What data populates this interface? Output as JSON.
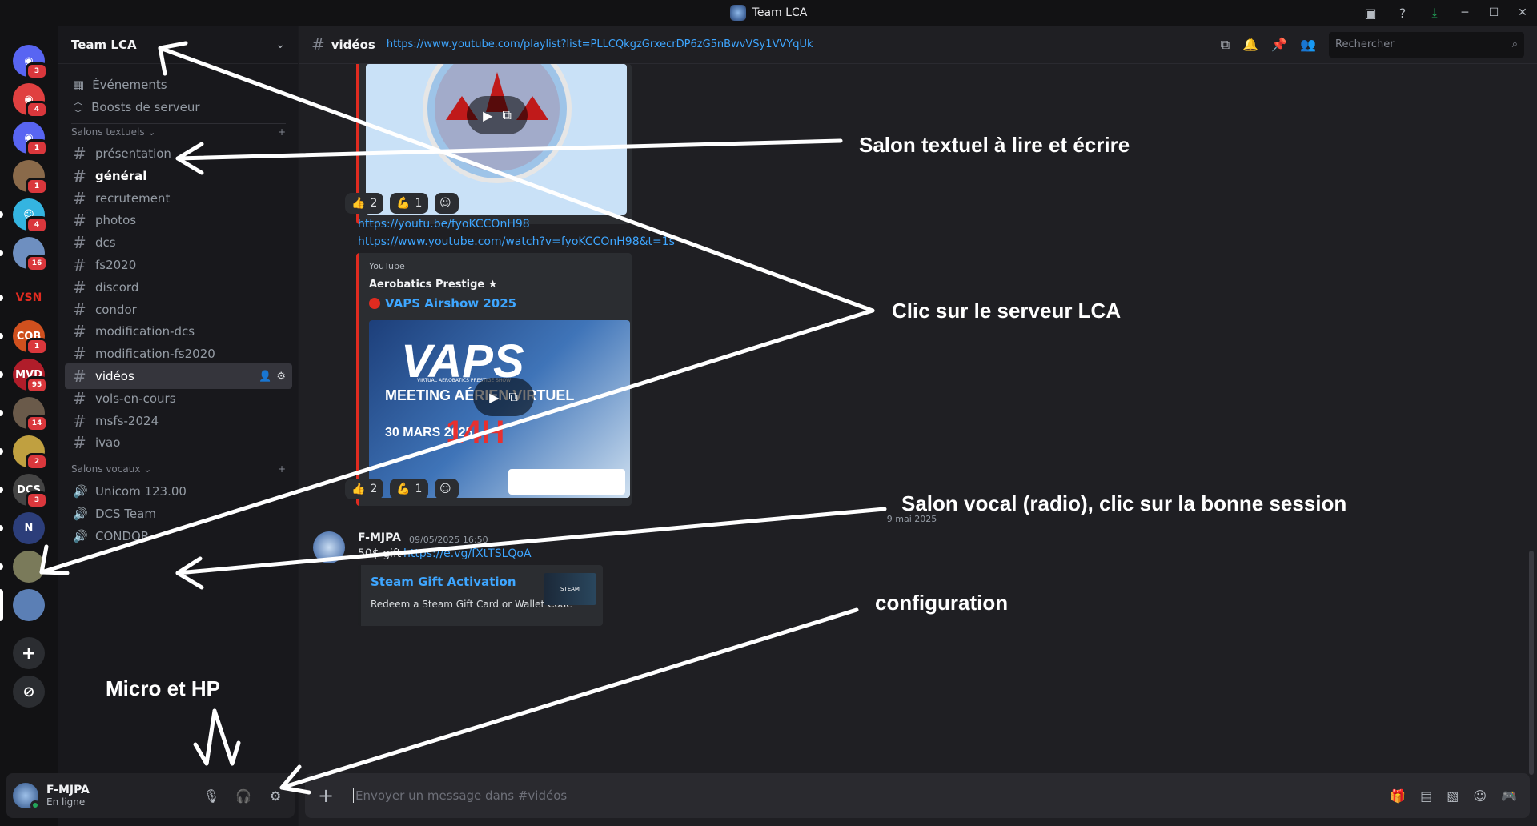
{
  "window": {
    "title": "Team LCA"
  },
  "rail": {
    "servers": [
      {
        "name": "discord-home",
        "badge": "3",
        "color": "#5865f2",
        "glyph": "◉"
      },
      {
        "name": "server-2",
        "badge": "4",
        "color": "#e04040",
        "glyph": "◉"
      },
      {
        "name": "server-3",
        "badge": "1",
        "color": "#5865f2",
        "glyph": "◉"
      },
      {
        "name": "server-4",
        "badge": "1",
        "color": "#8a6a4a",
        "glyph": ""
      },
      {
        "name": "server-5",
        "badge": "4",
        "color": "#34b4e0",
        "glyph": "☺"
      },
      {
        "name": "server-6",
        "badge": "16",
        "color": "#6e8fc0",
        "glyph": ""
      },
      {
        "name": "server-vsn",
        "badge": "",
        "color": "#121214",
        "glyph": "VSN"
      },
      {
        "name": "server-8",
        "badge": "1",
        "color": "#d0501e",
        "glyph": "CQB"
      },
      {
        "name": "server-mvd",
        "badge": "95",
        "color": "#b01d2a",
        "glyph": "MVD"
      },
      {
        "name": "server-10",
        "badge": "14",
        "color": "#6a5a4a",
        "glyph": ""
      },
      {
        "name": "server-11",
        "badge": "2",
        "color": "#c0a040",
        "glyph": ""
      },
      {
        "name": "server-dcs",
        "badge": "3",
        "color": "#444",
        "glyph": "DCS"
      },
      {
        "name": "server-13",
        "badge": "",
        "color": "#2c3e7a",
        "glyph": "N"
      },
      {
        "name": "server-14",
        "badge": "",
        "color": "#7a7a5a",
        "glyph": ""
      },
      {
        "name": "server-team-lca",
        "badge": "",
        "color": "#5b7fb5",
        "glyph": ""
      }
    ]
  },
  "guild": {
    "name": "Team LCA",
    "events_label": "Événements",
    "boosts_label": "Boosts de serveur",
    "text_category": "Salons textuels",
    "voice_category": "Salons vocaux",
    "text_channels": [
      "présentation",
      "général",
      "recrutement",
      "photos",
      "dcs",
      "fs2020",
      "discord",
      "condor",
      "modification-dcs",
      "modification-fs2020",
      "vidéos",
      "vols-en-cours",
      "msfs-2024",
      "ivao"
    ],
    "voice_channels": [
      "Unicom 123.00",
      "DCS Team",
      "CONDOR"
    ]
  },
  "user": {
    "name": "F-MJPA",
    "status": "En ligne"
  },
  "chat": {
    "channel_name": "vidéos",
    "topic": "https://www.youtube.com/playlist?list=PLLCQkgzGrxecrDP6zG5nBwvVSy1VVYqUk",
    "search_placeholder": "Rechercher",
    "reactions1": [
      {
        "emoji": "👍",
        "count": "2"
      },
      {
        "emoji": "💪",
        "count": "1"
      }
    ],
    "link1": "https://youtu.be/fyoKCCOnH98",
    "link2": "https://www.youtube.com/watch?v=fyoKCCOnH98&t=1s",
    "embed": {
      "provider": "YouTube",
      "author": "Aerobatics Prestige ★",
      "title": "VAPS Airshow 2025",
      "thumb_big": "VAPS",
      "thumb_sub": "MEETING AÉRIEN VIRTUEL",
      "thumb_date": "30 MARS 2025",
      "thumb_time": "14H",
      "thumb_tiny": "VIRTUAL AEROBATICS PRESTIGE SHOW"
    },
    "reactions2": [
      {
        "emoji": "👍",
        "count": "2"
      },
      {
        "emoji": "💪",
        "count": "1"
      }
    ],
    "date_separator": "9 mai 2025",
    "msg": {
      "author": "F-MJPA",
      "timestamp": "09/05/2025 16:50",
      "text_prefix": "50$ gift",
      "link": "https://e.vg/fXtTSLQoA",
      "card_title": "Steam Gift Activation",
      "card_desc": "Redeem a Steam Gift Card or Wallet Code",
      "card_logo_text": "STEAM"
    },
    "composer_placeholder": "Envoyer un message dans #vidéos"
  },
  "annotations": {
    "salon_textuel": "Salon textuel à lire et écrire",
    "clic_serveur": "Clic sur le serveur LCA",
    "salon_vocal": "Salon vocal (radio), clic sur la bonne session",
    "configuration": "configuration",
    "micro_hp": "Micro et HP"
  },
  "colors": {
    "accent_link": "#3ea6ff",
    "embed_border": "#e02b20",
    "online": "#23a55a",
    "badge": "#da373c"
  }
}
